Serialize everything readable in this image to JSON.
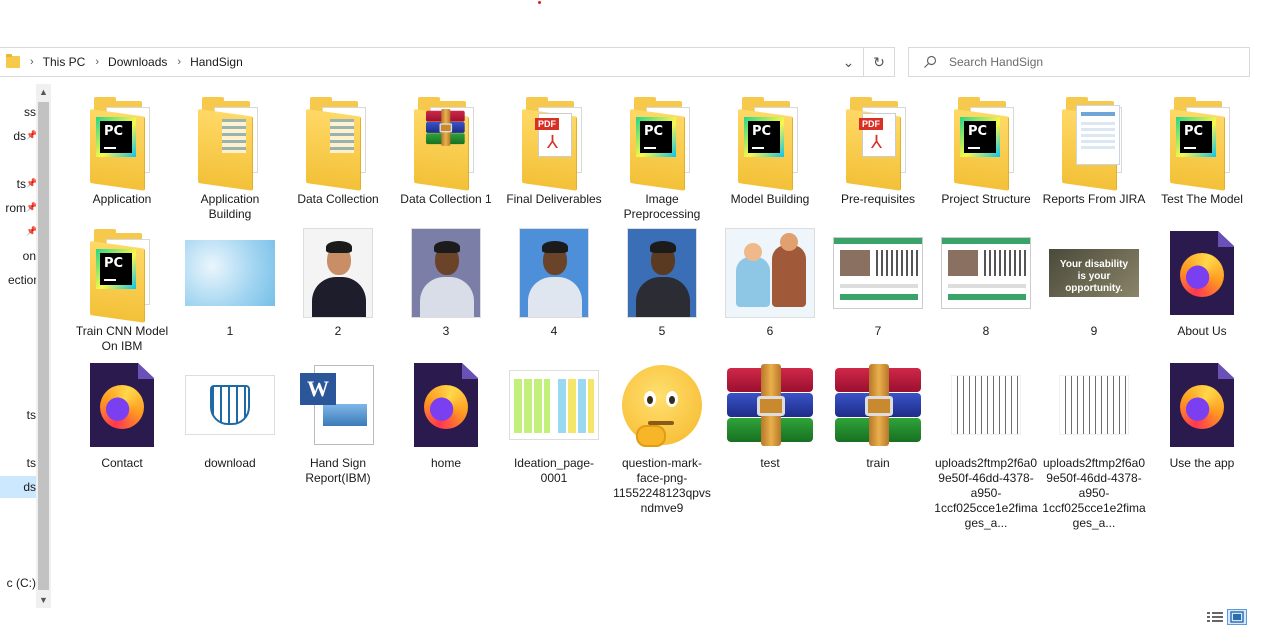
{
  "breadcrumb": [
    "This PC",
    "Downloads",
    "HandSign"
  ],
  "search": {
    "placeholder": "Search HandSign"
  },
  "nav": {
    "items": [
      {
        "label": "ss",
        "pinned": false
      },
      {
        "label": "ds",
        "pinned": true
      },
      {
        "label": "ts",
        "pinned": true
      },
      {
        "label": "rom",
        "pinned": true
      },
      {
        "label": "",
        "pinned": true
      },
      {
        "label": "on",
        "pinned": false
      },
      {
        "label": "ection",
        "pinned": false
      },
      {
        "label": "ts",
        "pinned": false
      },
      {
        "label": "ts",
        "pinned": false
      },
      {
        "label": "ds",
        "pinned": false
      },
      {
        "label": "c (C:)",
        "pinned": false
      }
    ]
  },
  "files": [
    {
      "name": "Application",
      "type": "folder",
      "overlay": "pycharm"
    },
    {
      "name": "Application Building",
      "type": "folder",
      "overlay": "docs"
    },
    {
      "name": "Data Collection",
      "type": "folder",
      "overlay": "docs"
    },
    {
      "name": "Data Collection 1",
      "type": "folder",
      "overlay": "winrar"
    },
    {
      "name": "Final Deliverables",
      "type": "folder",
      "overlay": "pdf"
    },
    {
      "name": "Image Preprocessing",
      "type": "folder",
      "overlay": "pycharm"
    },
    {
      "name": "Model Building",
      "type": "folder",
      "overlay": "pycharm"
    },
    {
      "name": "Pre-requisites",
      "type": "folder",
      "overlay": "pdf"
    },
    {
      "name": "Project Structure",
      "type": "folder",
      "overlay": "pycharm"
    },
    {
      "name": "Reports From JIRA",
      "type": "folder",
      "overlay": "screenshot"
    },
    {
      "name": "Test The Model",
      "type": "folder",
      "overlay": "pycharm"
    },
    {
      "name": "Train CNN Model On IBM",
      "type": "folder",
      "overlay": "pycharm"
    },
    {
      "name": "1",
      "type": "image",
      "overlay": "sky"
    },
    {
      "name": "2",
      "type": "image",
      "overlay": "portrait-suit"
    },
    {
      "name": "3",
      "type": "image",
      "overlay": "portrait-blue"
    },
    {
      "name": "4",
      "type": "image",
      "overlay": "portrait-light"
    },
    {
      "name": "5",
      "type": "image",
      "overlay": "portrait-dark"
    },
    {
      "name": "6",
      "type": "image",
      "overlay": "illustration"
    },
    {
      "name": "7",
      "type": "image",
      "overlay": "app-screenshot"
    },
    {
      "name": "8",
      "type": "image",
      "overlay": "app-screenshot"
    },
    {
      "name": "9",
      "type": "image",
      "overlay": "quote"
    },
    {
      "name": "About Us",
      "type": "html",
      "overlay": "firefox"
    },
    {
      "name": "Contact",
      "type": "html",
      "overlay": "firefox"
    },
    {
      "name": "download",
      "type": "image",
      "overlay": "emblem"
    },
    {
      "name": "Hand Sign Report(IBM)",
      "type": "docx",
      "overlay": "word"
    },
    {
      "name": "home",
      "type": "html",
      "overlay": "firefox"
    },
    {
      "name": "Ideation_page-0001",
      "type": "image",
      "overlay": "notes"
    },
    {
      "name": "question-mark-face-png-11552248123qpvsndmve9",
      "type": "image",
      "overlay": "emoji"
    },
    {
      "name": "test",
      "type": "archive",
      "overlay": "winrar"
    },
    {
      "name": "train",
      "type": "archive",
      "overlay": "winrar"
    },
    {
      "name": "uploads2ftmp2f6a09e50f-46dd-4378-a950-1ccf025cce1e2fimages_a...",
      "type": "image",
      "overlay": "signs"
    },
    {
      "name": "uploads2ftmp2f6a09e50f-46dd-4378-a950-1ccf025cce1e2fimages_a...",
      "type": "image",
      "overlay": "signs"
    },
    {
      "name": "Use the app",
      "type": "html",
      "overlay": "firefox"
    }
  ],
  "image9_text": "Your disability is your opportunity.",
  "colors": {
    "selection": "#cce8ff",
    "accent": "#0078d7"
  }
}
